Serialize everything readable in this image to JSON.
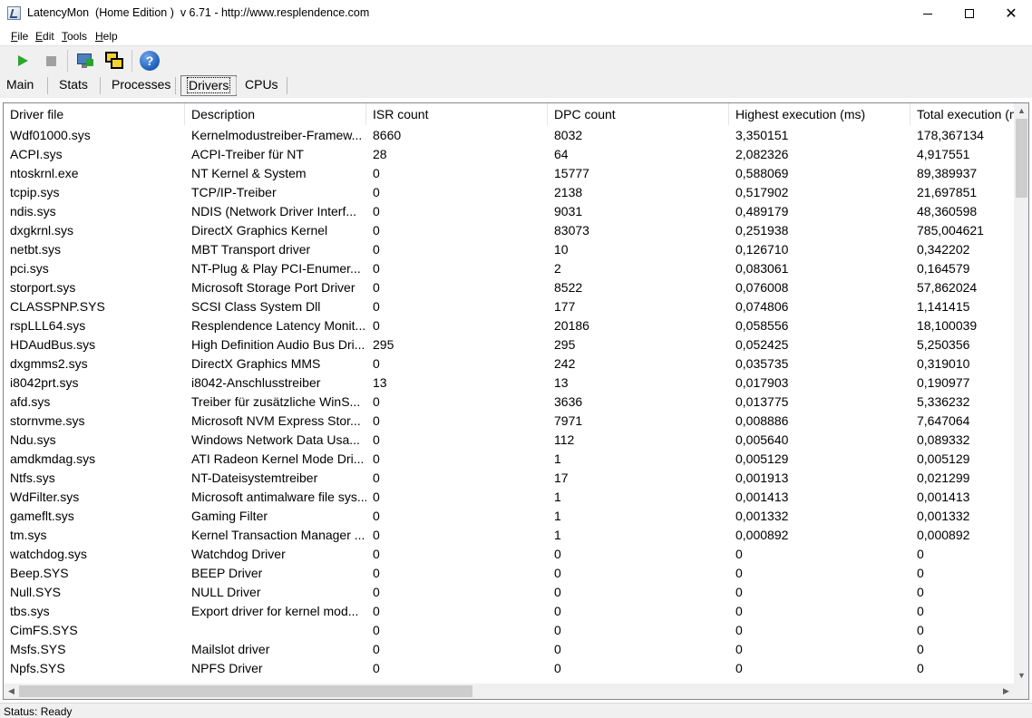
{
  "window": {
    "title": "LatencyMon  (Home Edition )  v 6.71 - http://www.resplendence.com",
    "minimize": "—",
    "close": "✕"
  },
  "menu": [
    {
      "key": "F",
      "rest": "ile"
    },
    {
      "key": "E",
      "rest": "dit"
    },
    {
      "key": "T",
      "rest": "ools"
    },
    {
      "key": "H",
      "rest": "elp"
    }
  ],
  "toolbar": {
    "icons": [
      "play-icon",
      "stop-icon",
      "report-icon",
      "windows-icon",
      "help-icon"
    ],
    "help_glyph": "?"
  },
  "tabs": [
    "Main",
    "Stats",
    "Processes",
    "Drivers",
    "CPUs"
  ],
  "active_tab": "Drivers",
  "table": {
    "columns": [
      "Driver file",
      "Description",
      "ISR count",
      "DPC count",
      "Highest execution (ms)",
      "Total execution (ms)"
    ],
    "rows": [
      [
        "Wdf01000.sys",
        "Kernelmodustreiber-Framew...",
        "8660",
        "8032",
        "3,350151",
        "178,367134"
      ],
      [
        "ACPI.sys",
        "ACPI-Treiber für NT",
        "28",
        "64",
        "2,082326",
        "4,917551"
      ],
      [
        "ntoskrnl.exe",
        "NT Kernel & System",
        "0",
        "15777",
        "0,588069",
        "89,389937"
      ],
      [
        "tcpip.sys",
        "TCP/IP-Treiber",
        "0",
        "2138",
        "0,517902",
        "21,697851"
      ],
      [
        "ndis.sys",
        "NDIS (Network Driver Interf...",
        "0",
        "9031",
        "0,489179",
        "48,360598"
      ],
      [
        "dxgkrnl.sys",
        "DirectX Graphics Kernel",
        "0",
        "83073",
        "0,251938",
        "785,004621"
      ],
      [
        "netbt.sys",
        "MBT Transport driver",
        "0",
        "10",
        "0,126710",
        "0,342202"
      ],
      [
        "pci.sys",
        "NT-Plug & Play PCI-Enumer...",
        "0",
        "2",
        "0,083061",
        "0,164579"
      ],
      [
        "storport.sys",
        "Microsoft Storage Port Driver",
        "0",
        "8522",
        "0,076008",
        "57,862024"
      ],
      [
        "CLASSPNP.SYS",
        "SCSI Class System Dll",
        "0",
        "177",
        "0,074806",
        "1,141415"
      ],
      [
        "rspLLL64.sys",
        "Resplendence Latency Monit...",
        "0",
        "20186",
        "0,058556",
        "18,100039"
      ],
      [
        "HDAudBus.sys",
        "High Definition Audio Bus Dri...",
        "295",
        "295",
        "0,052425",
        "5,250356"
      ],
      [
        "dxgmms2.sys",
        "DirectX Graphics MMS",
        "0",
        "242",
        "0,035735",
        "0,319010"
      ],
      [
        "i8042prt.sys",
        "i8042-Anschlusstreiber",
        "13",
        "13",
        "0,017903",
        "0,190977"
      ],
      [
        "afd.sys",
        "Treiber für zusätzliche WinS...",
        "0",
        "3636",
        "0,013775",
        "5,336232"
      ],
      [
        "stornvme.sys",
        "Microsoft NVM Express Stor...",
        "0",
        "7971",
        "0,008886",
        "7,647064"
      ],
      [
        "Ndu.sys",
        "Windows Network Data Usa...",
        "0",
        "112",
        "0,005640",
        "0,089332"
      ],
      [
        "amdkmdag.sys",
        "ATI Radeon Kernel Mode Dri...",
        "0",
        "1",
        "0,005129",
        "0,005129"
      ],
      [
        "Ntfs.sys",
        "NT-Dateisystemtreiber",
        "0",
        "17",
        "0,001913",
        "0,021299"
      ],
      [
        "WdFilter.sys",
        "Microsoft antimalware file sys...",
        "0",
        "1",
        "0,001413",
        "0,001413"
      ],
      [
        "gameflt.sys",
        "Gaming Filter",
        "0",
        "1",
        "0,001332",
        "0,001332"
      ],
      [
        "tm.sys",
        "Kernel Transaction Manager ...",
        "0",
        "1",
        "0,000892",
        "0,000892"
      ],
      [
        "watchdog.sys",
        "Watchdog Driver",
        "0",
        "0",
        "0",
        "0"
      ],
      [
        "Beep.SYS",
        "BEEP Driver",
        "0",
        "0",
        "0",
        "0"
      ],
      [
        "Null.SYS",
        "NULL Driver",
        "0",
        "0",
        "0",
        "0"
      ],
      [
        "tbs.sys",
        "Export driver for kernel mod...",
        "0",
        "0",
        "0",
        "0"
      ],
      [
        "CimFS.SYS",
        "",
        "0",
        "0",
        "0",
        "0"
      ],
      [
        "Msfs.SYS",
        "Mailslot driver",
        "0",
        "0",
        "0",
        "0"
      ],
      [
        "Npfs.SYS",
        "NPFS Driver",
        "0",
        "0",
        "0",
        "0"
      ]
    ]
  },
  "scroll": {
    "up": "▲",
    "down": "▼",
    "left": "◀",
    "right": "▶"
  },
  "status": "Status: Ready"
}
